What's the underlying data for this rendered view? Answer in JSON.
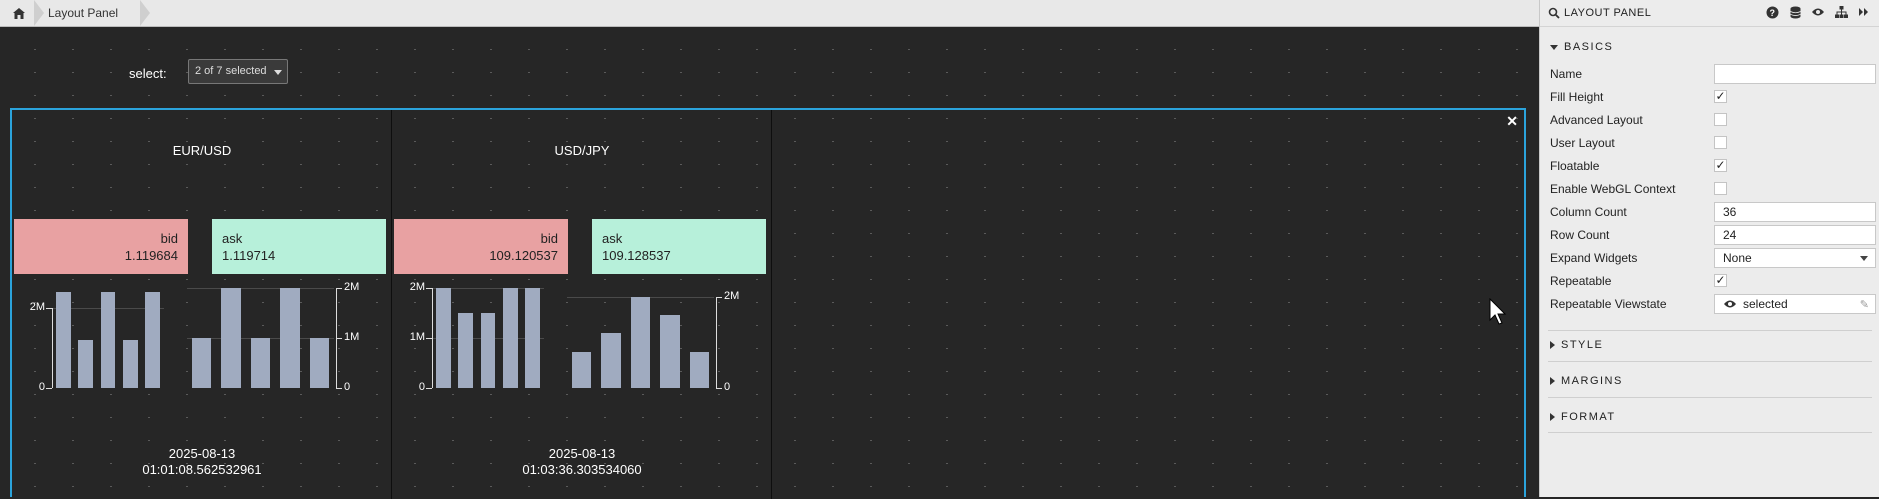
{
  "breadcrumb": {
    "home_icon": "home-icon",
    "current": "Layout Panel"
  },
  "selector": {
    "label": "select:",
    "value": "2 of 7 selected"
  },
  "panels": [
    {
      "title": "EUR/USD",
      "bid": {
        "label": "bid",
        "value": "1.119684"
      },
      "ask": {
        "label": "ask",
        "value": "1.119714"
      },
      "timestamp_date": "2025-08-13",
      "timestamp_time": "01:01:08.562532961",
      "left_axis_labels": [
        "2M",
        "0"
      ],
      "right_axis_labels": [
        "2M",
        "1M",
        "0"
      ]
    },
    {
      "title": "USD/JPY",
      "bid": {
        "label": "bid",
        "value": "109.120537"
      },
      "ask": {
        "label": "ask",
        "value": "109.128537"
      },
      "timestamp_date": "2025-08-13",
      "timestamp_time": "01:03:36.303534060",
      "left_axis_labels": [
        "2M",
        "1M",
        "0"
      ],
      "right_axis_labels": [
        "2M",
        "0"
      ]
    }
  ],
  "chart_data": [
    {
      "type": "bar",
      "title": "",
      "series": [
        {
          "values": [
            2.4,
            1.2,
            2.4,
            1.2,
            2.4
          ]
        }
      ],
      "ylim": [
        0,
        2.5
      ],
      "yticks": [
        "2M",
        "0"
      ]
    },
    {
      "type": "bar",
      "title": "",
      "series": [
        {
          "values": [
            1.0,
            2.0,
            1.0,
            2.0,
            1.0
          ]
        }
      ],
      "ylim": [
        0,
        2.0
      ],
      "yticks": [
        "2M",
        "1M",
        "0"
      ]
    },
    {
      "type": "bar",
      "title": "",
      "series": [
        {
          "values": [
            2.0,
            1.5,
            1.5,
            2.0,
            2.0
          ]
        }
      ],
      "ylim": [
        0,
        2.0
      ],
      "yticks": [
        "2M",
        "1M",
        "0"
      ]
    },
    {
      "type": "bar",
      "title": "",
      "series": [
        {
          "values": [
            0.8,
            1.2,
            2.0,
            1.6,
            0.8
          ]
        }
      ],
      "ylim": [
        0,
        2.2
      ],
      "yticks": [
        "2M",
        "0"
      ]
    }
  ],
  "right_panel": {
    "title": "LAYOUT PANEL",
    "header_icons": [
      "help-icon",
      "database-icon",
      "eye-icon",
      "hierarchy-icon",
      "expand-icon"
    ],
    "sections": {
      "basics": "BASICS",
      "style": "STYLE",
      "margins": "MARGINS",
      "format": "FORMAT"
    },
    "properties": [
      {
        "label": "Name",
        "type": "text",
        "value": ""
      },
      {
        "label": "Fill Height",
        "type": "check",
        "value": "✓"
      },
      {
        "label": "Advanced Layout",
        "type": "check",
        "value": ""
      },
      {
        "label": "User Layout",
        "type": "check",
        "value": ""
      },
      {
        "label": "Floatable",
        "type": "check",
        "value": "✓"
      },
      {
        "label": "Enable WebGL Context",
        "type": "check",
        "value": ""
      },
      {
        "label": "Column Count",
        "type": "text",
        "value": "36"
      },
      {
        "label": "Row Count",
        "type": "text",
        "value": "24"
      },
      {
        "label": "Expand Widgets",
        "type": "select",
        "value": "None"
      },
      {
        "label": "Repeatable",
        "type": "check",
        "value": "✓"
      },
      {
        "label": "Repeatable Viewstate",
        "type": "viewstate",
        "value": "selected"
      }
    ]
  },
  "colors": {
    "accent": "#2ba3db",
    "bid": "#e8a1a2",
    "ask": "#b7f0da",
    "bar": "#a0abc0"
  }
}
